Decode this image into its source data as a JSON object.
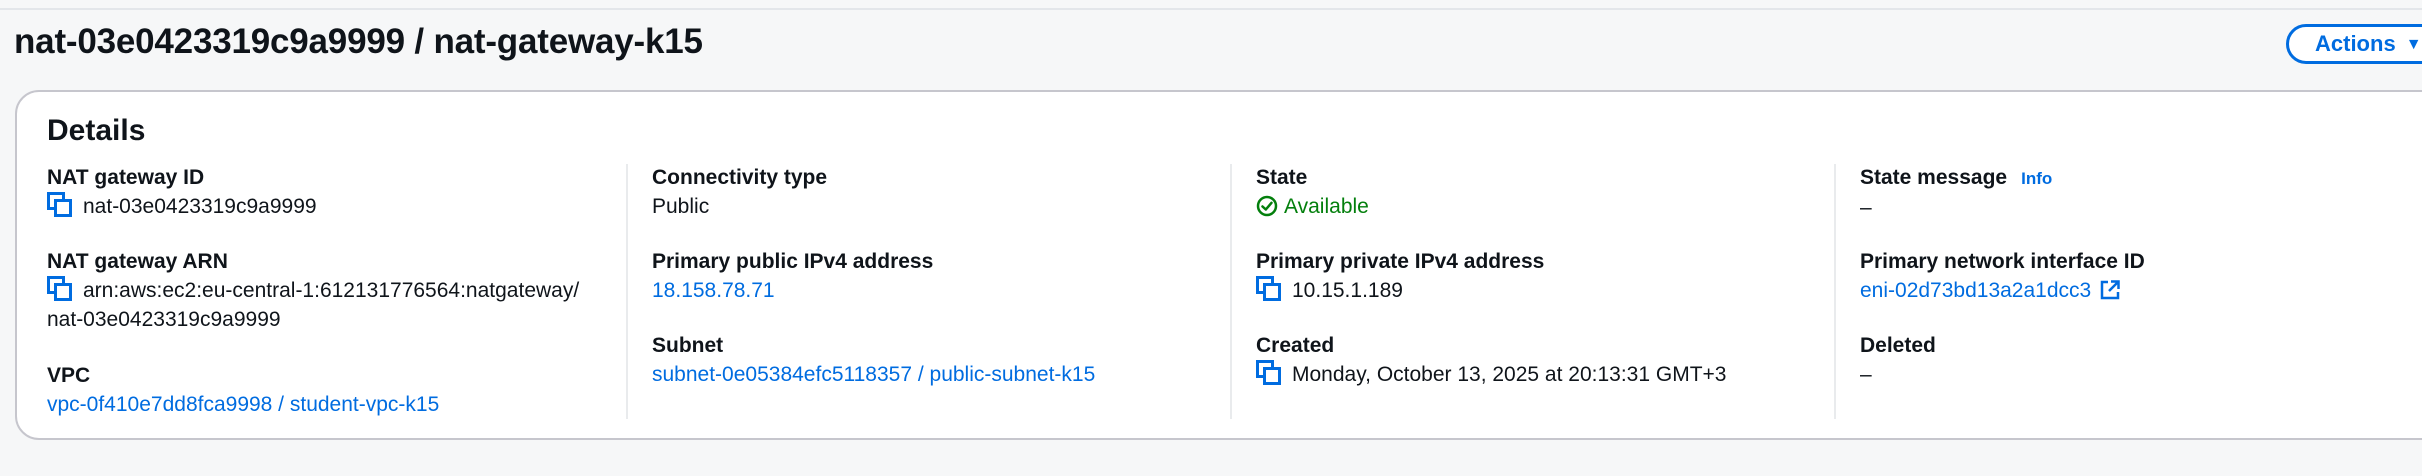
{
  "header": {
    "title": "nat-03e0423319c9a9999 / nat-gateway-k15",
    "actions_label": "Actions"
  },
  "details": {
    "title": "Details",
    "nat_gateway_id": {
      "label": "NAT gateway ID",
      "value": "nat-03e0423319c9a9999"
    },
    "nat_gateway_arn": {
      "label": "NAT gateway ARN",
      "value_line1": "arn:aws:ec2:eu-central-1:612131776564:natgateway/",
      "value_line2": "nat-03e0423319c9a9999"
    },
    "vpc": {
      "label": "VPC",
      "value": "vpc-0f410e7dd8fca9998 / student-vpc-k15"
    },
    "connectivity_type": {
      "label": "Connectivity type",
      "value": "Public"
    },
    "primary_public_ipv4": {
      "label": "Primary public IPv4 address",
      "value": "18.158.78.71"
    },
    "subnet": {
      "label": "Subnet",
      "value": "subnet-0e05384efc5118357 / public-subnet-k15"
    },
    "state": {
      "label": "State",
      "value": "Available"
    },
    "primary_private_ipv4": {
      "label": "Primary private IPv4 address",
      "value": "10.15.1.189"
    },
    "created": {
      "label": "Created",
      "value": "Monday, October 13, 2025 at 20:13:31 GMT+3"
    },
    "state_message": {
      "label": "State message",
      "info": "Info",
      "value": "–"
    },
    "primary_eni": {
      "label": "Primary network interface ID",
      "value": "eni-02d73bd13a2a1dcc3"
    },
    "deleted": {
      "label": "Deleted",
      "value": "–"
    }
  },
  "colors": {
    "link": "#006ce0",
    "success": "#037f0c",
    "border": "#c6c6cd",
    "text": "#0f141a"
  },
  "icons": [
    "copy-icon",
    "status-available-icon",
    "external-link-icon",
    "caret-down-icon"
  ]
}
